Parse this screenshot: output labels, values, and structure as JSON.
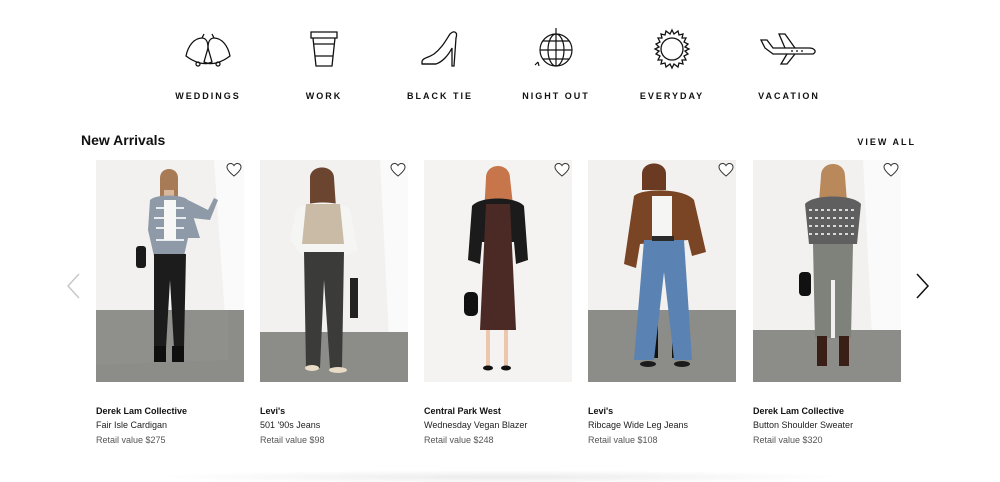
{
  "occasions": [
    {
      "label": "WEDDINGS",
      "icon": "wedding-bells-icon"
    },
    {
      "label": "WORK",
      "icon": "coffee-cup-icon"
    },
    {
      "label": "BLACK TIE",
      "icon": "high-heel-icon"
    },
    {
      "label": "NIGHT OUT",
      "icon": "disco-ball-icon"
    },
    {
      "label": "EVERYDAY",
      "icon": "sun-icon"
    },
    {
      "label": "VACATION",
      "icon": "airplane-icon"
    }
  ],
  "section": {
    "title": "New Arrivals",
    "view_all": "VIEW ALL"
  },
  "carousel": {
    "prev_icon": "chevron-left-icon",
    "next_icon": "chevron-right-icon"
  },
  "products": [
    {
      "brand": "Derek Lam Collective",
      "name": "Fair Isle Cardigan",
      "price": "Retail value $275"
    },
    {
      "brand": "Levi's",
      "name": "501 '90s Jeans",
      "price": "Retail value $98"
    },
    {
      "brand": "Central Park West",
      "name": "Wednesday Vegan Blazer",
      "price": "Retail value $248"
    },
    {
      "brand": "Levi's",
      "name": "Ribcage Wide Leg Jeans",
      "price": "Retail value $108"
    },
    {
      "brand": "Derek Lam Collective",
      "name": "Button Shoulder Sweater",
      "price": "Retail value $320"
    }
  ],
  "colors": {
    "text": "#111111",
    "muted": "#555555",
    "photo_bg": "#efeeec",
    "floor": "#8a8a86"
  }
}
